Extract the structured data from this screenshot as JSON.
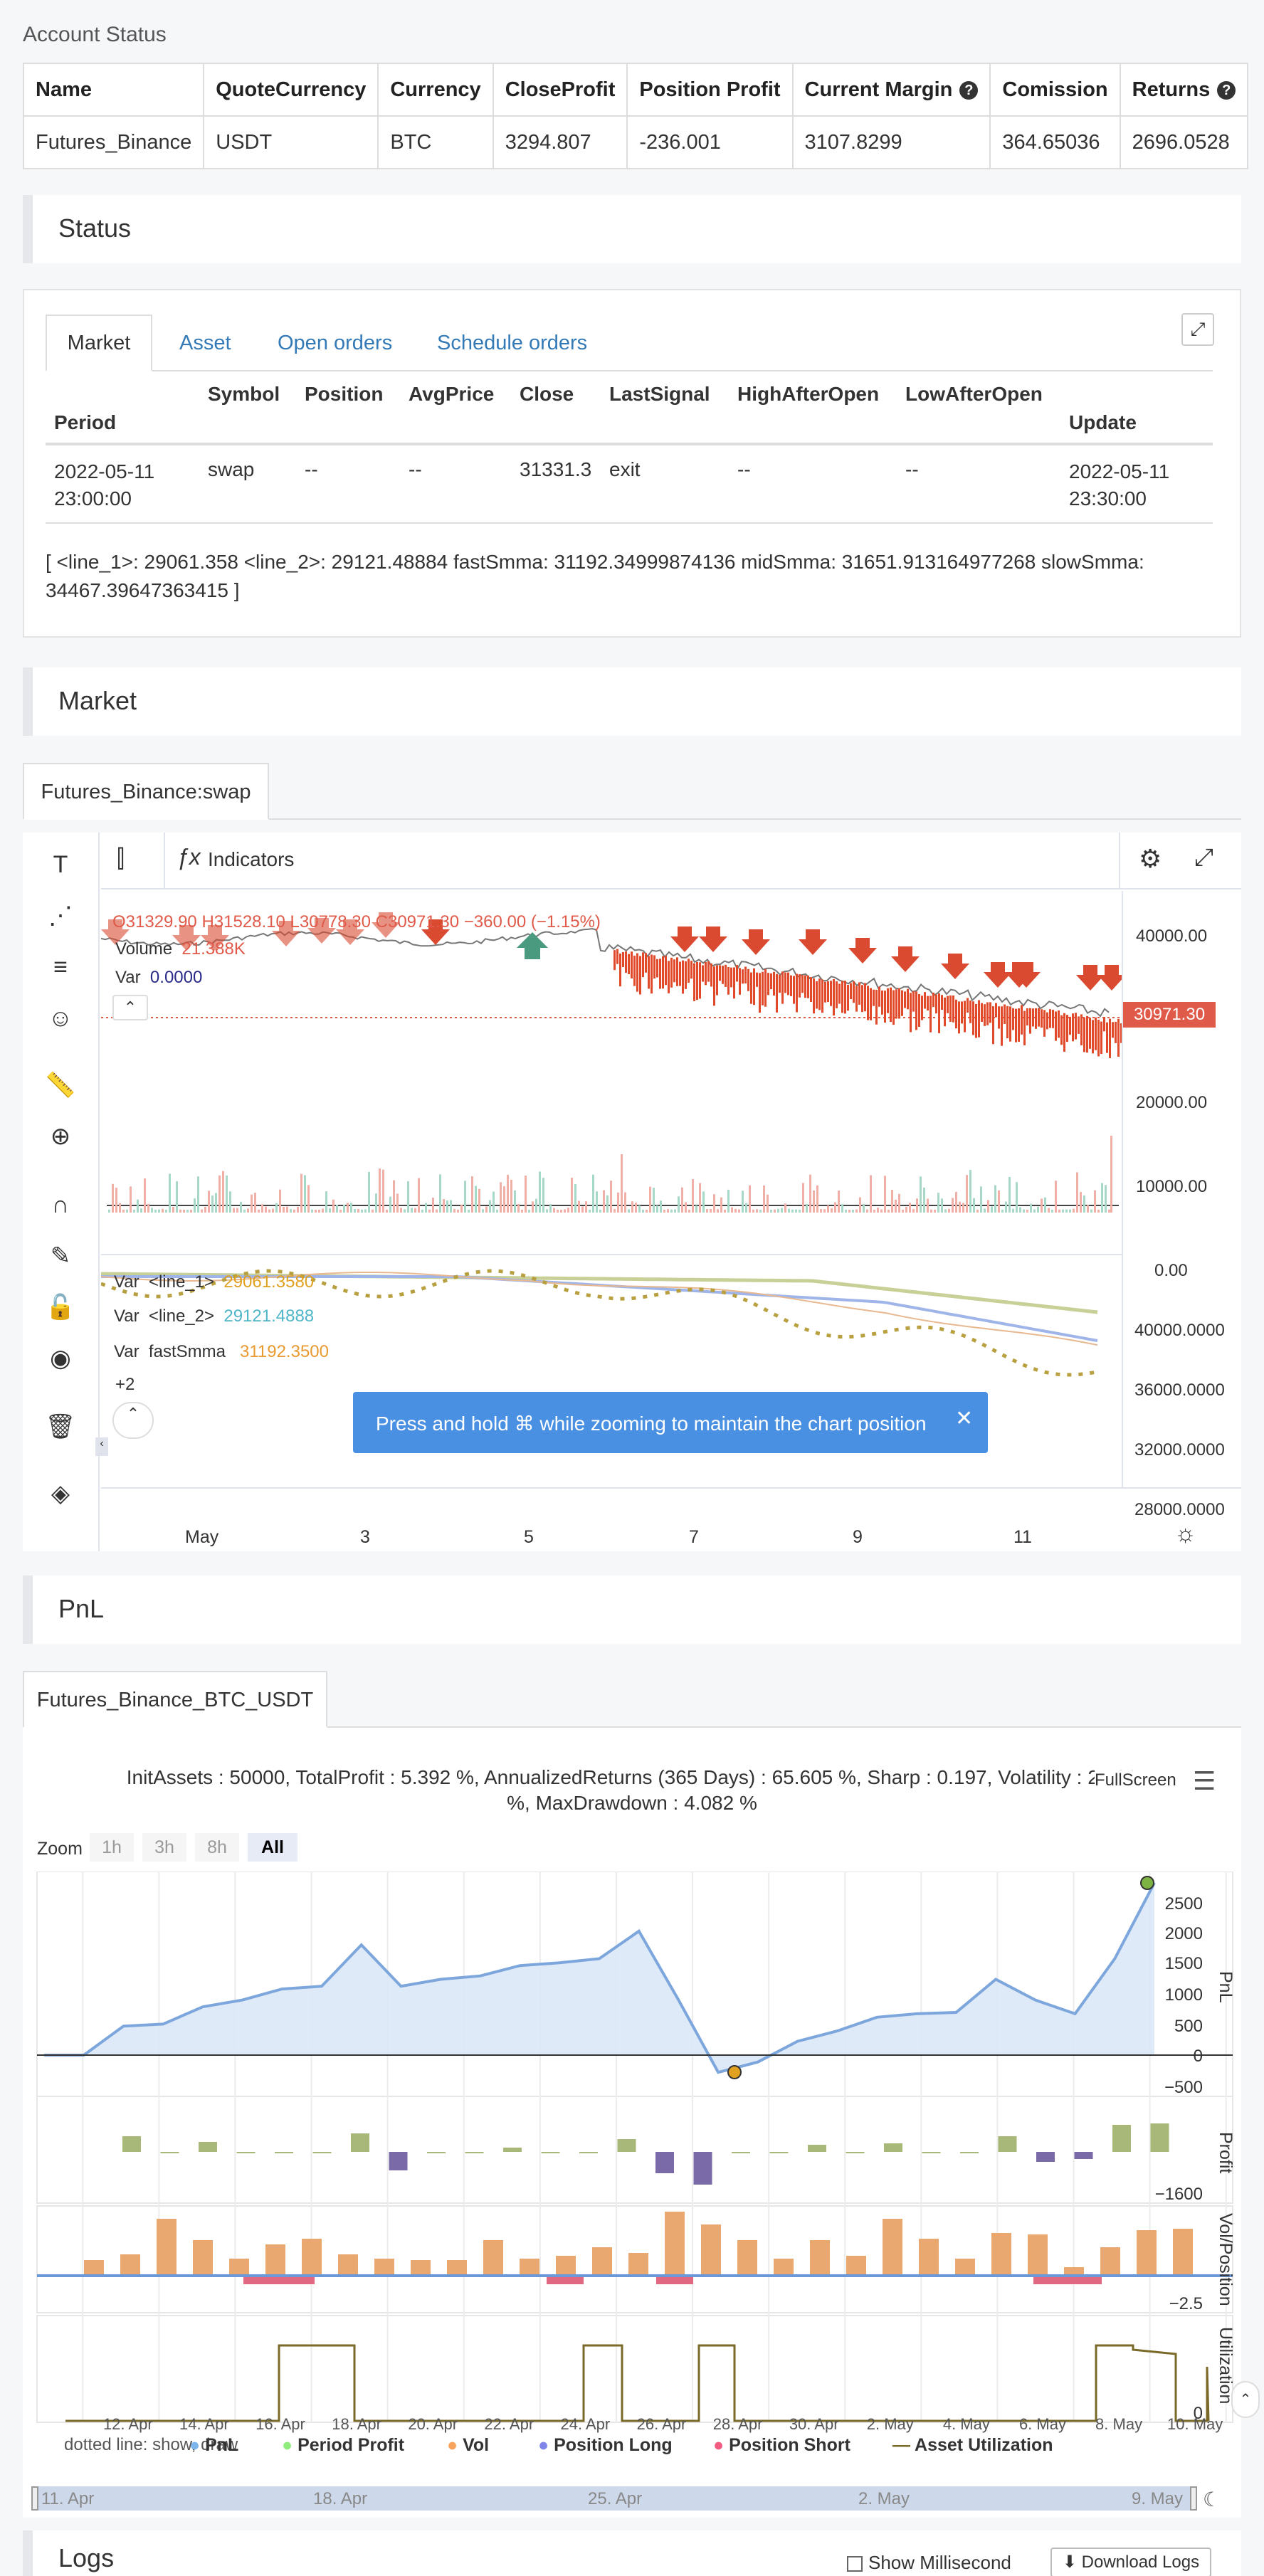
{
  "account": {
    "title": "Account Status",
    "headers": [
      "Name",
      "QuoteCurrency",
      "Currency",
      "CloseProfit",
      "Position Profit",
      "Current Margin",
      "Comission",
      "Returns"
    ],
    "row": [
      "Futures_Binance",
      "USDT",
      "BTC",
      "3294.807",
      "-236.001",
      "3107.8299",
      "364.65036",
      "2696.0528"
    ]
  },
  "status": {
    "title": "Status",
    "tabs": [
      "Market",
      "Asset",
      "Open orders",
      "Schedule orders"
    ],
    "headers": [
      "Period",
      "Symbol",
      "Position",
      "AvgPrice",
      "Close",
      "LastSignal",
      "HighAfterOpen",
      "LowAfterOpen",
      "Update"
    ],
    "row": {
      "period_line1": "2022-05-11",
      "period_line2": "23:00:00",
      "symbol": "swap",
      "position": "--",
      "avgprice": "--",
      "close": "31331.3",
      "lastsignal": "exit",
      "highafteropen": "--",
      "lowafteropen": "--",
      "update_line1": "2022-05-11",
      "update_line2": "23:30:00"
    },
    "info_line1": "[ <line_1>: 29061.358 <line_2>: 29121.48884 fastSmma: 31192.34999874136 midSmma: 31651.913164977268 slowSmma:",
    "info_line2": "34467.39647363415 ]"
  },
  "market": {
    "title": "Market",
    "tab": "Futures_Binance:swap",
    "indicators_label": "Indicators",
    "ohlc": "O31329.90 H31528.10 L30778.30 C30971.30 −360.00 (−1.15%)",
    "volume_label": "Volume",
    "volume_value": "21.388K",
    "var_label": "Var",
    "var_value": "0.0000",
    "price_badge": "30971.30",
    "price_axis": [
      "40000.00",
      "30000.00",
      "20000.00",
      "10000.00",
      "0.00"
    ],
    "sub_legend": [
      {
        "label": "Var",
        "name": "<line_1>",
        "value": "29061.3580",
        "color": "#e0a020"
      },
      {
        "label": "Var",
        "name": "<line_2>",
        "value": "29121.4888",
        "color": "#4fb6c9"
      },
      {
        "label": "Var",
        "name": "fastSmma",
        "value": "31192.3500",
        "color": "#e89a30"
      }
    ],
    "more_count": "+2",
    "sub_axis": [
      "40000.0000",
      "36000.0000",
      "32000.0000",
      "28000.0000"
    ],
    "toast": "Press and hold ⌘ while zooming to maintain the chart position",
    "x_labels": [
      "May",
      "3",
      "5",
      "7",
      "9",
      "11"
    ]
  },
  "pnl": {
    "title": "PnL",
    "tab": "Futures_Binance_BTC_USDT",
    "summary_line1": "InitAssets : 50000, TotalProfit : 5.392 %, AnnualizedReturns (365 Days) : 65.605 %, Sharp : 0.197, Volatility : 2.192",
    "summary_line2": "%, MaxDrawdown : 4.082 %",
    "fullscreen": "FullScreen",
    "zoom_label": "Zoom",
    "zoom_buttons": [
      "1h",
      "3h",
      "8h",
      "All"
    ],
    "pnl_axis": [
      "2500",
      "2000",
      "1500",
      "1000",
      "500",
      "0",
      "−500"
    ],
    "profit_axis": [
      "−1600"
    ],
    "vol_axis": [
      "−2.5"
    ],
    "util_axis": [
      "0"
    ],
    "panel_titles": [
      "PnL",
      "Profit",
      "Vol/Position",
      "Utilization"
    ],
    "x_labels": [
      "12. Apr",
      "14. Apr",
      "16. Apr",
      "18. Apr",
      "20. Apr",
      "22. Apr",
      "24. Apr",
      "26. Apr",
      "28. Apr",
      "30. Apr",
      "2. May",
      "4. May",
      "6. May",
      "8. May",
      "10. May"
    ],
    "legend_prefix": "dotted line: show, draw",
    "legend": [
      {
        "name": "PnL",
        "color": "#7cb5ec"
      },
      {
        "name": "Period Profit",
        "color": "#90ed7d"
      },
      {
        "name": "Vol",
        "color": "#f7a35c"
      },
      {
        "name": "Position Long",
        "color": "#8085e9"
      },
      {
        "name": "Position Short",
        "color": "#f15c80"
      },
      {
        "name": "Asset Utilization",
        "color": "#7a6a2a"
      }
    ],
    "navigator_labels": [
      "11. Apr",
      "18. Apr",
      "25. Apr",
      "2. May",
      "9. May"
    ]
  },
  "logs": {
    "title": "Logs",
    "show_ms": "Show Millisecond",
    "download": "Download Logs"
  },
  "colors": {
    "link": "#337ab7",
    "down": "#e04a2a",
    "up": "#4a9a80",
    "pnl_fill": "#dbe8f7"
  }
}
